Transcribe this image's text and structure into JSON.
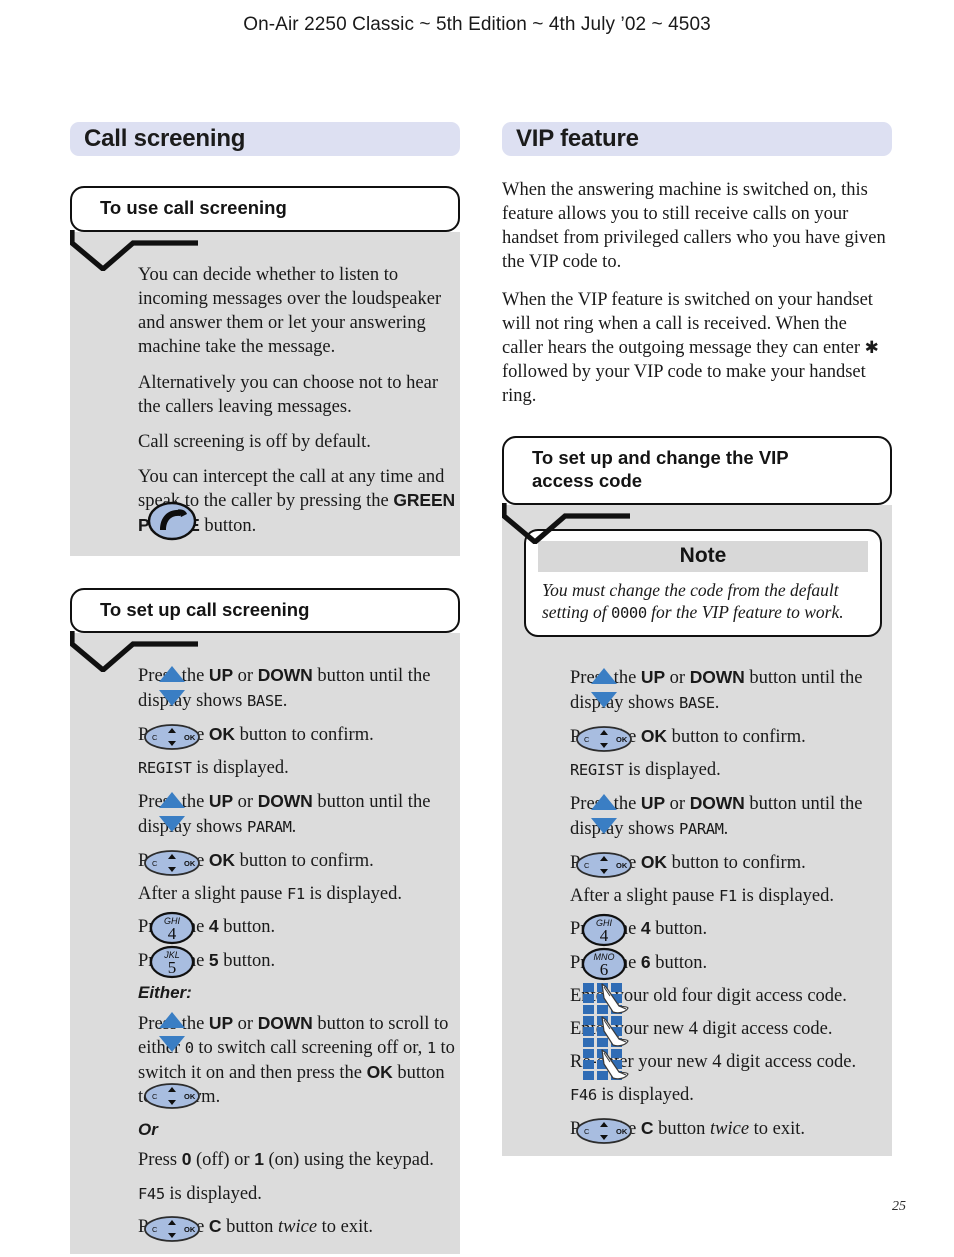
{
  "page": {
    "running_header": "On-Air 2250 Classic ~ 5th Edition ~ 4th July ’02 ~ 4503",
    "folio": "25"
  },
  "colors": {
    "heading_bar": "#dde0f2",
    "rail_grey": "#dcdcdc",
    "key_blue": "#a8bde0",
    "keypad_blue": "#2f6cb5",
    "note_header_grey": "#d8d8d8"
  },
  "left_column": {
    "section_heading": "Call screening",
    "blocks": [
      {
        "callout": "To use call screening",
        "steps": [
          {
            "icon": "none",
            "text": "You can decide whether to listen to incoming messages over the loudspeaker and answer them or let your answering machine take the message."
          },
          {
            "icon": "none",
            "text": "Alternatively you can choose not to hear the callers leaving messages."
          },
          {
            "icon": "none",
            "text": "Call screening is off by default."
          },
          {
            "icon": "green-phone-key-icon",
            "text": "You can intercept the call at any time and speak to the caller by pressing the GREEN PHONE button.",
            "bold_runs": [
              "GREEN PHONE"
            ]
          }
        ]
      },
      {
        "callout": "To set up call screening",
        "steps": [
          {
            "icon": "up-down-key-icon",
            "text": "Press the UP or DOWN button until the display shows BASE.",
            "bold_runs": [
              "UP",
              "DOWN"
            ],
            "lcd_runs": [
              "BASE"
            ]
          },
          {
            "icon": "nav-ok-key-icon",
            "text": "Press the OK button to confirm.",
            "bold_runs": [
              "OK"
            ]
          },
          {
            "icon": "none",
            "text": "REGIST is displayed.",
            "lcd_runs": [
              "REGIST"
            ]
          },
          {
            "icon": "up-down-key-icon",
            "text": "Press the UP or DOWN button until the display shows PARAM.",
            "bold_runs": [
              "UP",
              "DOWN"
            ],
            "lcd_runs": [
              "PARAM"
            ]
          },
          {
            "icon": "nav-ok-key-icon",
            "text": "Press the OK button to confirm.",
            "bold_runs": [
              "OK"
            ]
          },
          {
            "icon": "none",
            "text": "After a slight pause F1 is displayed.",
            "lcd_runs": [
              "F1"
            ]
          },
          {
            "icon": "number-key-4-icon",
            "text": "Press the 4 button.",
            "bold_runs": [
              "4"
            ],
            "key_letters": "GHI",
            "key_digit": "4"
          },
          {
            "icon": "number-key-5-icon",
            "text": "Press the 5 button.",
            "bold_runs": [
              "5"
            ],
            "key_letters": "JKL",
            "key_digit": "5"
          },
          {
            "icon": "none",
            "text": "Either:",
            "style": "or-label"
          },
          {
            "icon": "up-down-key-icon",
            "text": "Press the UP or DOWN button to scroll to either 0 to switch call screening off or, 1 to switch it on and then press the OK button to confirm.",
            "bold_runs": [
              "UP",
              "DOWN",
              "OK"
            ],
            "lcd_runs": [
              "0",
              "1"
            ],
            "icon2": "nav-ok-key-icon"
          },
          {
            "icon": "none",
            "text": "Or",
            "style": "or-label"
          },
          {
            "icon": "none",
            "text": "Press 0 (off) or 1 (on) using the keypad.",
            "bold_runs": [
              "0",
              "1"
            ]
          },
          {
            "icon": "none",
            "text": "F45 is displayed.",
            "lcd_runs": [
              "F45"
            ]
          },
          {
            "icon": "nav-ok-key-icon",
            "text": "Press the C button twice to exit.",
            "bold_runs": [
              "C"
            ],
            "italic_runs": [
              "twice"
            ]
          }
        ]
      }
    ]
  },
  "right_column": {
    "section_heading": "VIP feature",
    "intro_paragraphs": [
      "When the answering machine is switched on, this feature allows you to still receive calls on your handset from privileged callers who you have given the VIP code to.",
      "When the VIP feature is switched on your handset will not ring when a call is received. When the caller hears the outgoing message they can enter ✱ followed by your VIP code to make your handset ring."
    ],
    "blocks": [
      {
        "callout": "To set up and change the VIP access code",
        "note": {
          "title": "Note",
          "body": "You must change the code from the default setting of 0000 for the VIP feature to work.",
          "lcd_runs": [
            "0000"
          ]
        },
        "steps": [
          {
            "icon": "up-down-key-icon",
            "text": "Press the UP or DOWN button until the display shows BASE.",
            "bold_runs": [
              "UP",
              "DOWN"
            ],
            "lcd_runs": [
              "BASE"
            ]
          },
          {
            "icon": "nav-ok-key-icon",
            "text": "Press the OK button to confirm.",
            "bold_runs": [
              "OK"
            ]
          },
          {
            "icon": "none",
            "text": "REGIST is displayed.",
            "lcd_runs": [
              "REGIST"
            ]
          },
          {
            "icon": "up-down-key-icon",
            "text": "Press the UP or DOWN button until the display shows PARAM.",
            "bold_runs": [
              "UP",
              "DOWN"
            ],
            "lcd_runs": [
              "PARAM"
            ]
          },
          {
            "icon": "nav-ok-key-icon",
            "text": "Press the OK button to confirm.",
            "bold_runs": [
              "OK"
            ]
          },
          {
            "icon": "none",
            "text": "After a slight pause F1 is displayed.",
            "lcd_runs": [
              "F1"
            ]
          },
          {
            "icon": "number-key-4-icon",
            "text": "Press the 4 button.",
            "bold_runs": [
              "4"
            ],
            "key_letters": "GHI",
            "key_digit": "4"
          },
          {
            "icon": "number-key-6-icon",
            "text": "Press the 6 button.",
            "bold_runs": [
              "6"
            ],
            "key_letters": "MNO",
            "key_digit": "6"
          },
          {
            "icon": "keypad-entry-icon",
            "text": "Enter your old four digit access code."
          },
          {
            "icon": "keypad-entry-icon",
            "text": "Enter your new 4 digit access code."
          },
          {
            "icon": "keypad-entry-icon",
            "text": "Re-enter your new 4 digit access code."
          },
          {
            "icon": "none",
            "text": "F46 is displayed.",
            "lcd_runs": [
              "F46"
            ]
          },
          {
            "icon": "nav-ok-key-icon",
            "text": "Press the C button twice to exit.",
            "bold_runs": [
              "C"
            ],
            "italic_runs": [
              "twice"
            ]
          }
        ]
      }
    ]
  },
  "icon_labels": {
    "up_down": "up-down-key-icon",
    "nav_ok": "nav-ok-key-icon",
    "green_phone": "green-phone-key-icon",
    "keypad": "keypad-entry-icon",
    "number_key": "number-key-icon"
  }
}
